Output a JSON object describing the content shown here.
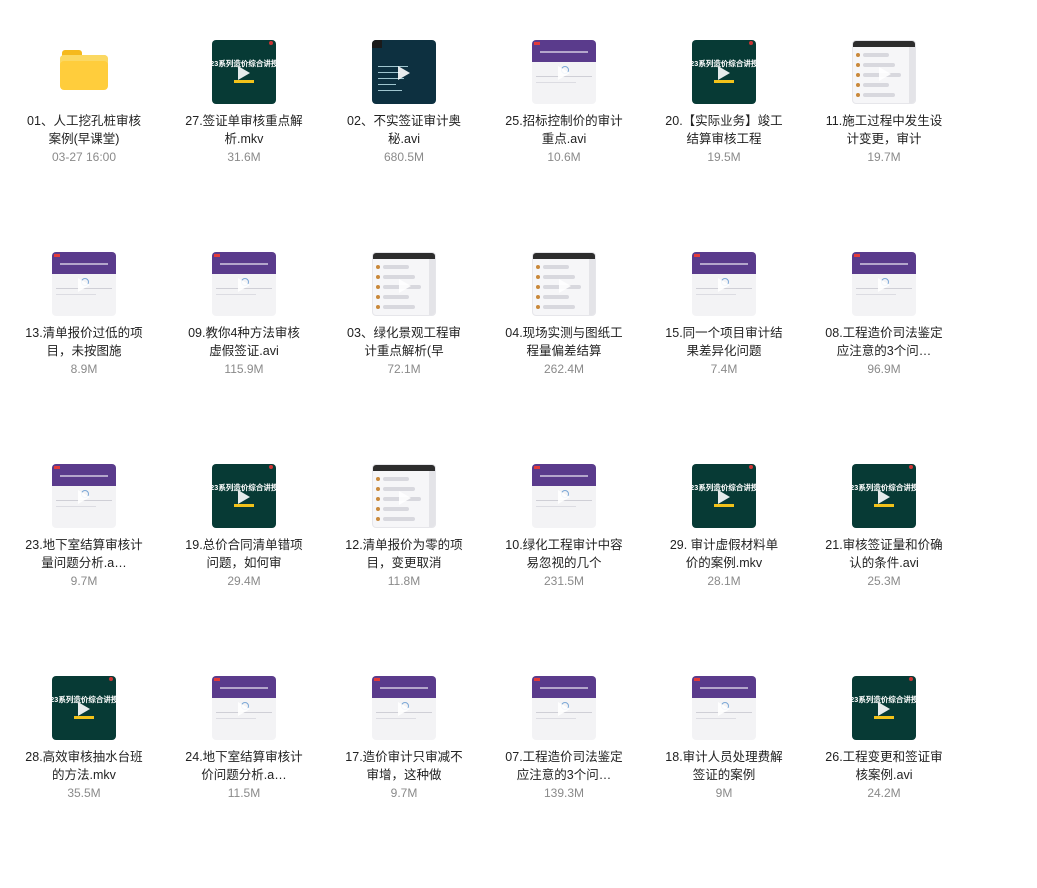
{
  "files": [
    [
      {
        "name": "01、人工挖孔桩审核案例(早课堂)",
        "meta": "03-27 16:00",
        "kind": "folder"
      },
      {
        "name": "27.签证单审核重点解析.mkv",
        "meta": "31.6M",
        "kind": "green",
        "thumb_text": "23系列造价综合讲授"
      },
      {
        "name": "02、不实签证审计奥秘.avi",
        "meta": "680.5M",
        "kind": "dark"
      },
      {
        "name": "25.招标控制价的审计重点.avi",
        "meta": "10.6M",
        "kind": "purple"
      },
      {
        "name": "20.【实际业务】竣工结算审核工程",
        "meta": "19.5M",
        "kind": "green",
        "thumb_text": "23系列造价综合讲授"
      },
      {
        "name": "11.施工过程中发生设计变更，审计",
        "meta": "19.7M",
        "kind": "chat"
      }
    ],
    [
      {
        "name": "13.清单报价过低的项目，未按图施",
        "meta": "8.9M",
        "kind": "purple"
      },
      {
        "name": "09.教你4种方法审核虚假签证.avi",
        "meta": "115.9M",
        "kind": "purple"
      },
      {
        "name": "03、绿化景观工程审计重点解析(早",
        "meta": "72.1M",
        "kind": "chat"
      },
      {
        "name": "04.现场实测与图纸工程量偏差结算",
        "meta": "262.4M",
        "kind": "chat"
      },
      {
        "name": "15.同一个项目审计结果差异化问题",
        "meta": "7.4M",
        "kind": "purple"
      },
      {
        "name": "08.工程造价司法鉴定应注意的3个问…",
        "meta": "96.9M",
        "kind": "purple"
      }
    ],
    [
      {
        "name": "23.地下室结算审核计量问题分析.a…",
        "meta": "9.7M",
        "kind": "purple"
      },
      {
        "name": "19.总价合同清单错项问题，如何审",
        "meta": "29.4M",
        "kind": "green",
        "thumb_text": "23系列造价综合讲授"
      },
      {
        "name": "12.清单报价为零的项目，变更取消",
        "meta": "11.8M",
        "kind": "chat"
      },
      {
        "name": "10.绿化工程审计中容易忽视的几个",
        "meta": "231.5M",
        "kind": "purple"
      },
      {
        "name": "29. 审计虚假材料单价的案例.mkv",
        "meta": "28.1M",
        "kind": "green",
        "thumb_text": "23系列造价综合讲授"
      },
      {
        "name": "21.审核签证量和价确认的条件.avi",
        "meta": "25.3M",
        "kind": "green",
        "thumb_text": "23系列造价综合讲授"
      }
    ],
    [
      {
        "name": "28.高效审核抽水台班的方法.mkv",
        "meta": "35.5M",
        "kind": "green",
        "thumb_text": "23系列造价综合讲授"
      },
      {
        "name": "24.地下室结算审核计价问题分析.a…",
        "meta": "11.5M",
        "kind": "purple"
      },
      {
        "name": "17.造价审计只审减不审增，这种做",
        "meta": "9.7M",
        "kind": "purple"
      },
      {
        "name": "07.工程造价司法鉴定应注意的3个问…",
        "meta": "139.3M",
        "kind": "purple"
      },
      {
        "name": "18.审计人员处理费解签证的案例",
        "meta": "9M",
        "kind": "purple"
      },
      {
        "name": "26.工程变更和签证审核案例.avi",
        "meta": "24.2M",
        "kind": "green",
        "thumb_text": "23系列造价综合讲授"
      }
    ]
  ],
  "icons": {
    "folder": "folder-icon",
    "video": "video-thumbnail",
    "play": "play-icon"
  },
  "colors": {
    "folder": "#ffcd3c",
    "green_thumb": "#073a35",
    "purple_band": "#5a3b8c",
    "meta_text": "#8a8a8a"
  }
}
